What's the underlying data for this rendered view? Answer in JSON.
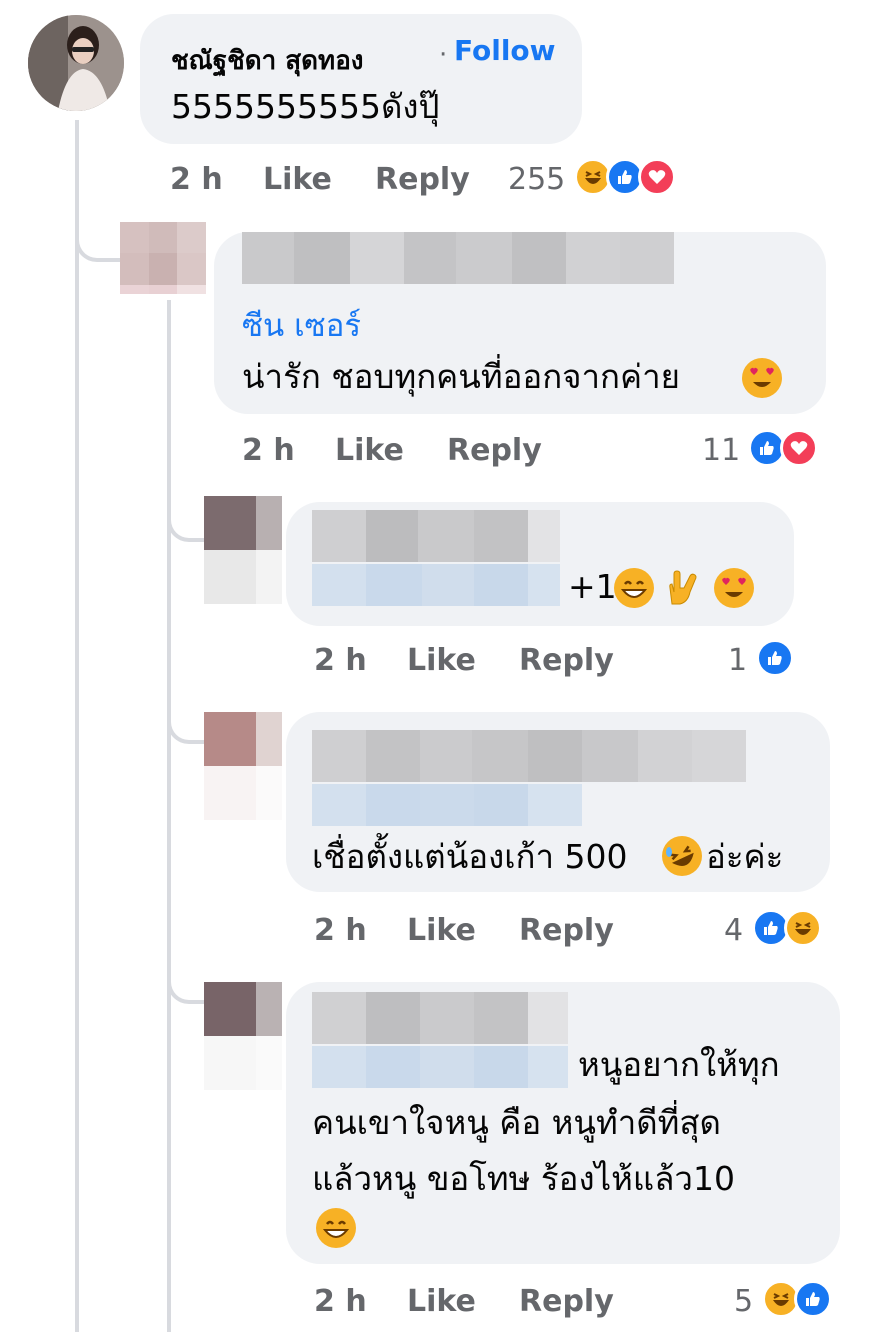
{
  "comments": [
    {
      "name": "ชณัฐชิดา สุดทอง",
      "follow_sep": "·",
      "follow_label": "Follow",
      "text": "5555555555ดังปุ๊",
      "time": "2 h",
      "like_label": "Like",
      "reply_label": "Reply",
      "reaction_count": "255",
      "reactions": [
        "haha-icon",
        "like-icon",
        "love-icon"
      ]
    },
    {
      "mention": "ซีน เซอร์",
      "text": "น่ารัก ชอบทุกคนที่ออกจากค่าย",
      "time": "2 h",
      "like_label": "Like",
      "reply_label": "Reply",
      "reaction_count": "11",
      "reactions": [
        "like-icon",
        "love-icon"
      ]
    },
    {
      "text": "+1",
      "time": "2 h",
      "like_label": "Like",
      "reply_label": "Reply",
      "reaction_count": "1",
      "reactions": [
        "like-icon"
      ]
    },
    {
      "text_a": "เชื่อตั้งแต่น้องเก้า 500",
      "text_b": "อ่ะค่ะ",
      "time": "2 h",
      "like_label": "Like",
      "reply_label": "Reply",
      "reaction_count": "4",
      "reactions": [
        "like-icon",
        "haha-icon"
      ]
    },
    {
      "line1": "หนูอยากให้ทุก",
      "line2": "คนเขาใจหนู คือ  หนูทำดีที่สุด",
      "line3": "แล้วหนู ขอโทษ ร้องไห้แล้ว10",
      "time": "2 h",
      "like_label": "Like",
      "reply_label": "Reply",
      "reaction_count": "5",
      "reactions": [
        "haha-icon",
        "like-icon"
      ]
    }
  ],
  "colors": {
    "accent": "#1877f2",
    "love": "#f33e58",
    "emoji": "#f7b125",
    "bubble": "#f0f2f5",
    "meta": "#65676b"
  }
}
